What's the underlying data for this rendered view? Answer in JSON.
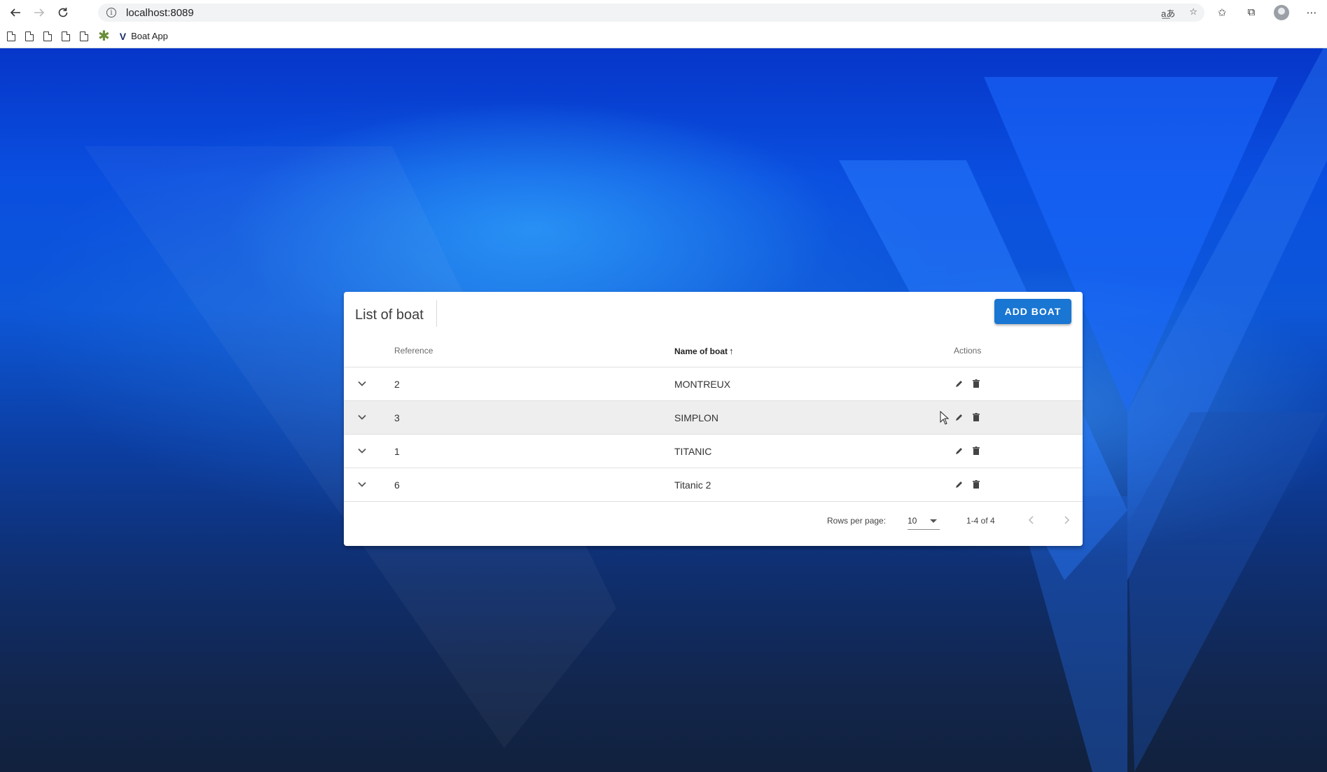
{
  "browser": {
    "url": "localhost:8089",
    "bookmarks": {
      "app_label": "Boat App"
    }
  },
  "card": {
    "title": "List of boat",
    "add_button_label": "ADD BOAT",
    "columns": {
      "reference": "Reference",
      "name": "Name of boat",
      "actions": "Actions"
    },
    "rows": [
      {
        "reference": "2",
        "name": "MONTREUX"
      },
      {
        "reference": "3",
        "name": "SIMPLON"
      },
      {
        "reference": "1",
        "name": "TITANIC"
      },
      {
        "reference": "6",
        "name": "Titanic 2"
      }
    ],
    "footer": {
      "rows_per_page_label": "Rows per page:",
      "rows_per_page_value": "10",
      "range_text": "1-4 of 4"
    }
  },
  "colors": {
    "accent": "#1976d2",
    "background_top": "#0a4fe0",
    "background_bottom": "#11213d"
  }
}
